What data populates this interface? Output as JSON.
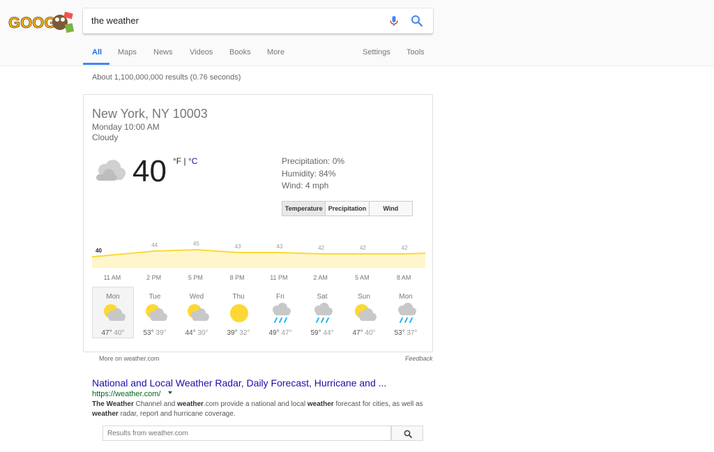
{
  "search": {
    "query": "the weather"
  },
  "tabs": [
    {
      "label": "All",
      "active": true
    },
    {
      "label": "Maps"
    },
    {
      "label": "News"
    },
    {
      "label": "Videos"
    },
    {
      "label": "Books"
    },
    {
      "label": "More"
    },
    {
      "label": "Settings"
    },
    {
      "label": "Tools"
    }
  ],
  "result_stats": "About 1,100,000,000 results (0.76 seconds)",
  "weather": {
    "location": "New York, NY 10003",
    "time": "Monday 10:00 AM",
    "condition": "Cloudy",
    "temp": "40",
    "unit_f": "°F",
    "unit_sep": " | ",
    "unit_c": "°C",
    "precipitation": "Precipitation: 0%",
    "humidity": "Humidity: 84%",
    "wind": "Wind: 4 mph",
    "toggle": [
      "Temperature",
      "Precipitation",
      "Wind"
    ],
    "hourly": {
      "times": [
        "11 AM",
        "2 PM",
        "5 PM",
        "8 PM",
        "11 PM",
        "2 AM",
        "5 AM",
        "8 AM"
      ],
      "temps": [
        40,
        44,
        45,
        43,
        43,
        42,
        42,
        42
      ],
      "color": "#fdd835",
      "fill": "#fff6cc"
    },
    "days": [
      {
        "name": "Mon",
        "icon": "partly-cloudy-icon",
        "hi": "47°",
        "lo": "40°"
      },
      {
        "name": "Tue",
        "icon": "partly-cloudy-icon",
        "hi": "53°",
        "lo": "39°"
      },
      {
        "name": "Wed",
        "icon": "partly-cloudy-icon",
        "hi": "44°",
        "lo": "30°"
      },
      {
        "name": "Thu",
        "icon": "sunny-icon",
        "hi": "39°",
        "lo": "32°"
      },
      {
        "name": "Fri",
        "icon": "rain-icon",
        "hi": "49°",
        "lo": "47°"
      },
      {
        "name": "Sat",
        "icon": "rain-icon",
        "hi": "59°",
        "lo": "44°"
      },
      {
        "name": "Sun",
        "icon": "partly-cloudy-icon",
        "hi": "47°",
        "lo": "40°"
      },
      {
        "name": "Mon",
        "icon": "rain-icon",
        "hi": "53°",
        "lo": "37°"
      }
    ],
    "more_on": "More on weather.com",
    "feedback": "Feedback"
  },
  "result": {
    "title": "National and Local Weather Radar, Daily Forecast, Hurricane and ...",
    "url": "https://weather.com/",
    "snippet_parts": [
      {
        "text": "The Weather",
        "bold": true
      },
      {
        "text": " Channel and ",
        "bold": false
      },
      {
        "text": "weather",
        "bold": true
      },
      {
        "text": ".com provide a national and local ",
        "bold": false
      },
      {
        "text": "weather",
        "bold": true
      },
      {
        "text": " forecast for cities, as well as ",
        "bold": false
      },
      {
        "text": "weather",
        "bold": true
      },
      {
        "text": " radar, report and hurricane coverage.",
        "bold": false
      }
    ],
    "site_search_placeholder": "Results from weather.com"
  },
  "colors": {
    "accent": "#4285f4",
    "link": "#1a0dab",
    "url": "#006621",
    "sun": "#fdd835",
    "cloud": "#c8c8c8",
    "rain": "#29b6f6"
  }
}
